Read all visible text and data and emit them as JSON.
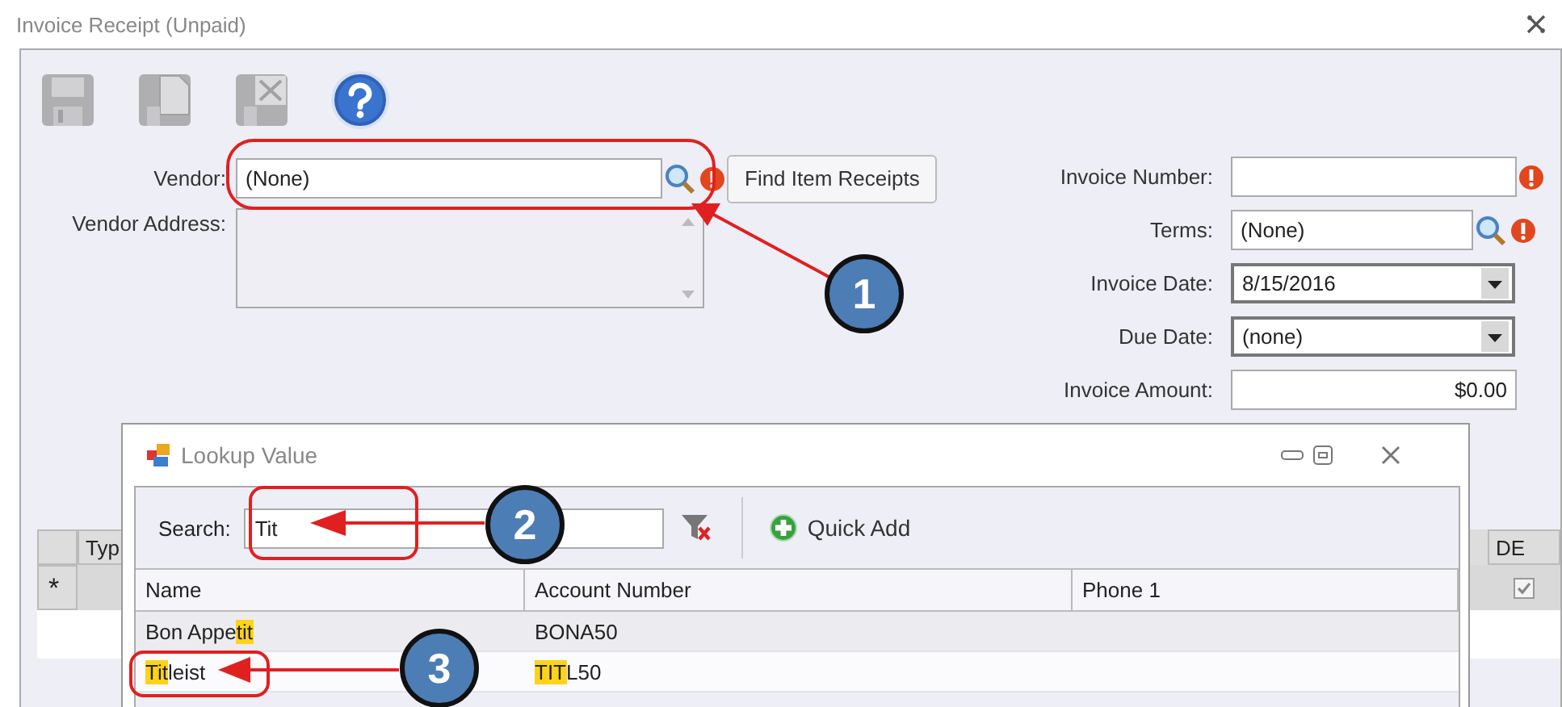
{
  "window": {
    "title": "Invoice Receipt (Unpaid)"
  },
  "toolbar": [
    {
      "kind": "save",
      "disabled": true
    },
    {
      "kind": "save_new",
      "disabled": true
    },
    {
      "kind": "delete",
      "disabled": true
    },
    {
      "kind": "help",
      "disabled": false
    }
  ],
  "vendor": {
    "label": "Vendor:",
    "value": "(None)",
    "required": true
  },
  "find_button": "Find Item Receipts",
  "vendor_address": {
    "label": "Vendor Address:"
  },
  "right_fields": [
    {
      "kind": "text",
      "label": "Invoice Number:",
      "required": true
    },
    {
      "kind": "lookup",
      "label": "Terms:",
      "value": "(None)",
      "required": true
    },
    {
      "kind": "dropdown",
      "label": "Invoice Date:",
      "value": "8/15/2016",
      "required": false
    },
    {
      "kind": "dropdown",
      "label": "Due Date:",
      "value": "(none)",
      "required": false
    },
    {
      "kind": "amount",
      "label": "Invoice Amount:",
      "value": "$0.00",
      "required": false
    }
  ],
  "line_grid": {
    "columns": [
      "Typ",
      "DE"
    ],
    "new_row_marker": "*",
    "de_checked": true
  },
  "lookup_dialog": {
    "title": "Lookup Value",
    "search": {
      "label": "Search:",
      "value": "Tit"
    },
    "quick_add": "Quick Add",
    "columns": [
      "Name",
      "Account Number",
      "Phone 1"
    ],
    "rows": [
      {
        "selected": false,
        "name": [
          {
            "text": "Bon Appe",
            "match": false
          },
          {
            "text": "tit",
            "match": true
          }
        ],
        "account": [
          {
            "text": "BONA50",
            "match": false
          }
        ]
      },
      {
        "selected": false,
        "name": [
          {
            "text": "Tit",
            "match": true
          },
          {
            "text": "leist",
            "match": false
          }
        ],
        "account": [
          {
            "text": "TIT",
            "match": true
          },
          {
            "text": "L50",
            "match": false
          }
        ]
      }
    ]
  },
  "callouts": [
    {
      "number": "1"
    },
    {
      "number": "2"
    },
    {
      "number": "3"
    }
  ]
}
